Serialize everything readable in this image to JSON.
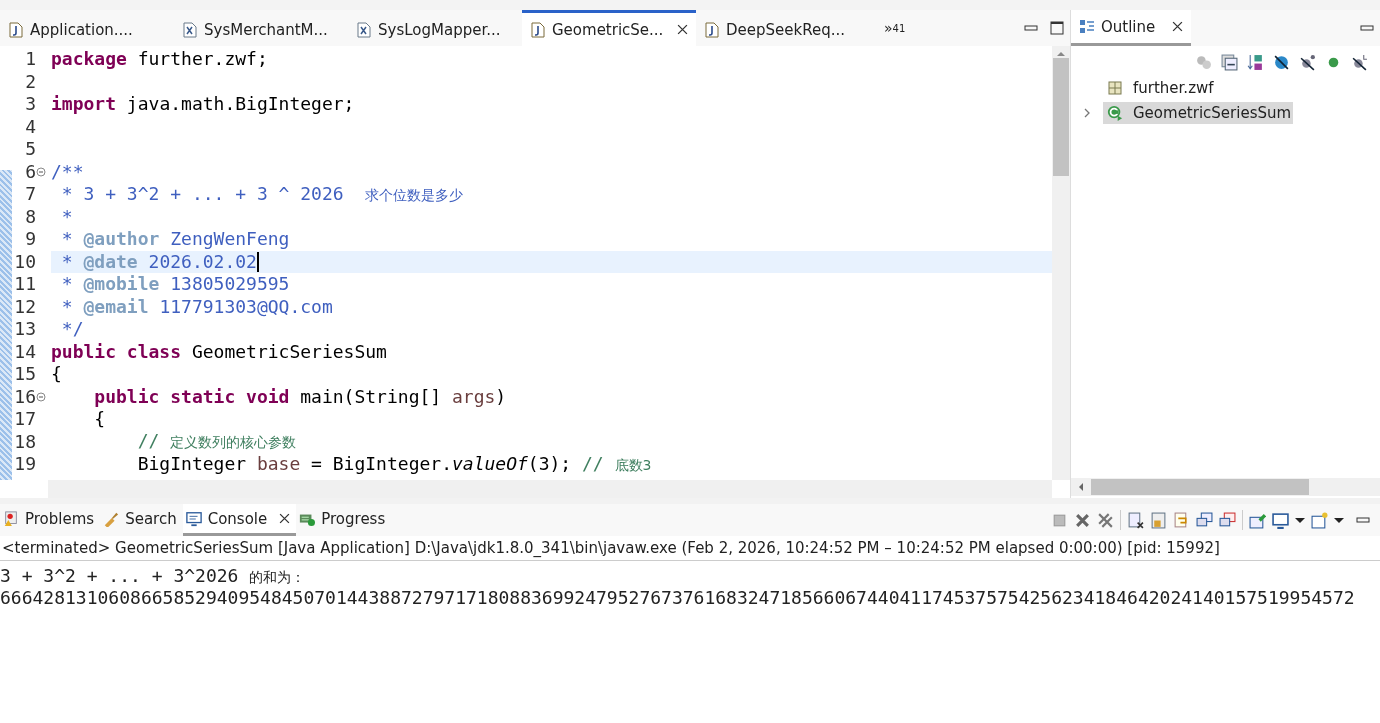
{
  "editor": {
    "tabs": [
      {
        "label": "Application....",
        "kind": "java",
        "selected": false
      },
      {
        "label": "SysMerchantM...",
        "kind": "xml",
        "selected": false
      },
      {
        "label": "SysLogMapper...",
        "kind": "xml",
        "selected": false
      },
      {
        "label": "GeometricSe...",
        "kind": "java",
        "selected": true
      },
      {
        "label": "DeepSeekReq...",
        "kind": "java",
        "selected": false
      }
    ],
    "overflow": "»",
    "overflow_count": "41",
    "lines": [
      {
        "number": "1",
        "fold": false,
        "current": false,
        "tokens": [
          {
            "kind": "kw",
            "t": "package"
          },
          {
            "kind": "plain",
            "t": " further.zwf;"
          }
        ]
      },
      {
        "number": "2",
        "fold": false,
        "current": false
      },
      {
        "number": "3",
        "fold": false,
        "current": false,
        "tokens": [
          {
            "kind": "kw",
            "t": "import"
          },
          {
            "kind": "plain",
            "t": " java.math.BigInteger;"
          }
        ]
      },
      {
        "number": "4",
        "fold": false,
        "current": false
      },
      {
        "number": "5",
        "fold": false,
        "current": false
      },
      {
        "number": "6",
        "fold": true,
        "current": false,
        "tokens": [
          {
            "kind": "doc",
            "t": "/**"
          }
        ]
      },
      {
        "number": "7",
        "fold": false,
        "current": false,
        "tokens": [
          {
            "kind": "doc",
            "t": " * 3 + 3^2 + ... + 3 ^ 2026  "
          },
          {
            "kind": "doccjk",
            "t": "求个位数是多少"
          }
        ]
      },
      {
        "number": "8",
        "fold": false,
        "current": false,
        "tokens": [
          {
            "kind": "doc",
            "t": " *"
          }
        ]
      },
      {
        "number": "9",
        "fold": false,
        "current": false,
        "tokens": [
          {
            "kind": "doc",
            "t": " * "
          },
          {
            "kind": "tag",
            "t": "@author"
          },
          {
            "kind": "doc",
            "t": " ZengWenFeng"
          }
        ]
      },
      {
        "number": "10",
        "fold": false,
        "current": true,
        "tokens": [
          {
            "kind": "doc",
            "t": " * "
          },
          {
            "kind": "tag",
            "t": "@date"
          },
          {
            "kind": "doc",
            "t": " 2026.02.02"
          }
        ]
      },
      {
        "number": "11",
        "fold": false,
        "current": false,
        "tokens": [
          {
            "kind": "doc",
            "t": " * "
          },
          {
            "kind": "tag",
            "t": "@mobile"
          },
          {
            "kind": "doc",
            "t": " 13805029595"
          }
        ]
      },
      {
        "number": "12",
        "fold": false,
        "current": false,
        "tokens": [
          {
            "kind": "doc",
            "t": " * "
          },
          {
            "kind": "tag",
            "t": "@email"
          },
          {
            "kind": "doc",
            "t": " 117791303@QQ.com"
          }
        ]
      },
      {
        "number": "13",
        "fold": false,
        "current": false,
        "tokens": [
          {
            "kind": "doc",
            "t": " */"
          }
        ]
      },
      {
        "number": "14",
        "fold": false,
        "current": false,
        "tokens": [
          {
            "kind": "kw",
            "t": "public class"
          },
          {
            "kind": "plain",
            "t": " GeometricSeriesSum"
          }
        ]
      },
      {
        "number": "15",
        "fold": false,
        "current": false,
        "tokens": [
          {
            "kind": "plain",
            "t": "{"
          }
        ]
      },
      {
        "number": "16",
        "fold": true,
        "current": false,
        "tokens": [
          {
            "kind": "kw",
            "t": "    public static void"
          },
          {
            "kind": "plain",
            "t": " main(String[] "
          },
          {
            "kind": "var",
            "t": "args"
          },
          {
            "kind": "plain",
            "t": ")"
          }
        ]
      },
      {
        "number": "17",
        "fold": false,
        "current": false,
        "tokens": [
          {
            "kind": "plain",
            "t": "    {"
          }
        ]
      },
      {
        "number": "18",
        "fold": false,
        "current": false,
        "tokens": [
          {
            "kind": "comment",
            "t": "        // "
          },
          {
            "kind": "commentcjk",
            "t": "定义数列的核心参数"
          }
        ]
      },
      {
        "number": "19",
        "fold": false,
        "current": false,
        "tokens": [
          {
            "kind": "plain",
            "t": "        BigInteger "
          },
          {
            "kind": "var",
            "t": "base"
          },
          {
            "kind": "plain",
            "t": " = BigInteger."
          },
          {
            "kind": "method",
            "t": "valueOf"
          },
          {
            "kind": "plain",
            "t": "(3); "
          },
          {
            "kind": "comment",
            "t": "// "
          },
          {
            "kind": "commentcjk",
            "t": "底数3"
          }
        ]
      }
    ]
  },
  "outline": {
    "tab": "Outline",
    "items": [
      {
        "label": "further.zwf",
        "kind": "package",
        "selected": false,
        "expandable": false
      },
      {
        "label": "GeometricSeriesSum",
        "kind": "class",
        "selected": true,
        "expandable": true
      }
    ]
  },
  "bottom": {
    "tabs": [
      {
        "label": "Problems",
        "kind": "problems",
        "selected": false
      },
      {
        "label": "Search",
        "kind": "search",
        "selected": false
      },
      {
        "label": "Console",
        "kind": "console",
        "selected": true
      },
      {
        "label": "Progress",
        "kind": "progress",
        "selected": false
      }
    ],
    "status": "<terminated> GeometricSeriesSum [Java Application] D:\\Java\\jdk1.8.0_341\\bin\\javaw.exe  (Feb 2, 2026, 10:24:52 PM – 10:24:52 PM elapsed 0:00:00) [pid: 15992]",
    "output": [
      {
        "parts": [
          {
            "kind": "plain",
            "t": "3 + 3^2 + ... + 3^2026 "
          },
          {
            "kind": "cjk",
            "t": "的和为："
          }
        ]
      },
      {
        "parts": [
          {
            "kind": "plain",
            "t": "66642813106086658529409548450701443887279717180883699247952767376168324718566067440411745375754256234184642024140157519954572"
          }
        ]
      }
    ]
  }
}
